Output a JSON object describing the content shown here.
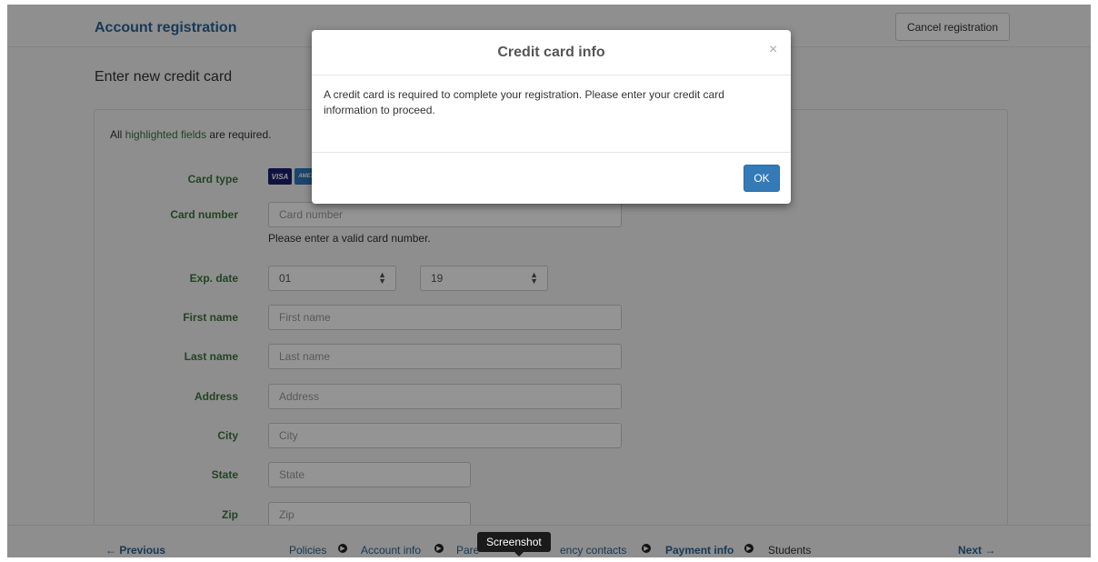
{
  "header": {
    "title": "Account registration",
    "cancel_label": "Cancel registration"
  },
  "form": {
    "section_title": "Enter new credit card",
    "required_note_prefix": "All ",
    "required_note_highlight": "highlighted fields",
    "required_note_suffix": " are required.",
    "card_type_label": "Card type",
    "card_icons": [
      "VISA",
      "AMEX"
    ],
    "card_number": {
      "label": "Card number",
      "placeholder": "Card number",
      "help": "Please enter a valid card number."
    },
    "exp_date": {
      "label": "Exp. date",
      "month": "01",
      "year": "19"
    },
    "first_name": {
      "label": "First name",
      "placeholder": "First name"
    },
    "last_name": {
      "label": "Last name",
      "placeholder": "Last name"
    },
    "address": {
      "label": "Address",
      "placeholder": "Address"
    },
    "city": {
      "label": "City",
      "placeholder": "City"
    },
    "state": {
      "label": "State",
      "placeholder": "State"
    },
    "zip": {
      "label": "Zip",
      "placeholder": "Zip"
    }
  },
  "footer": {
    "previous": "← Previous",
    "steps": [
      "Policies",
      "Account info",
      "Pare",
      "ency contacts",
      "Payment info",
      "Students"
    ],
    "next": "Next →"
  },
  "modal": {
    "title": "Credit card info",
    "close": "×",
    "body": "A credit card is required to complete your registration. Please enter your credit card information to proceed.",
    "ok": "OK"
  },
  "tooltip": {
    "text": "Screenshot"
  },
  "colors": {
    "accent": "#337ab7",
    "label_green": "#3c763d",
    "link_blue": "#2a6496"
  }
}
